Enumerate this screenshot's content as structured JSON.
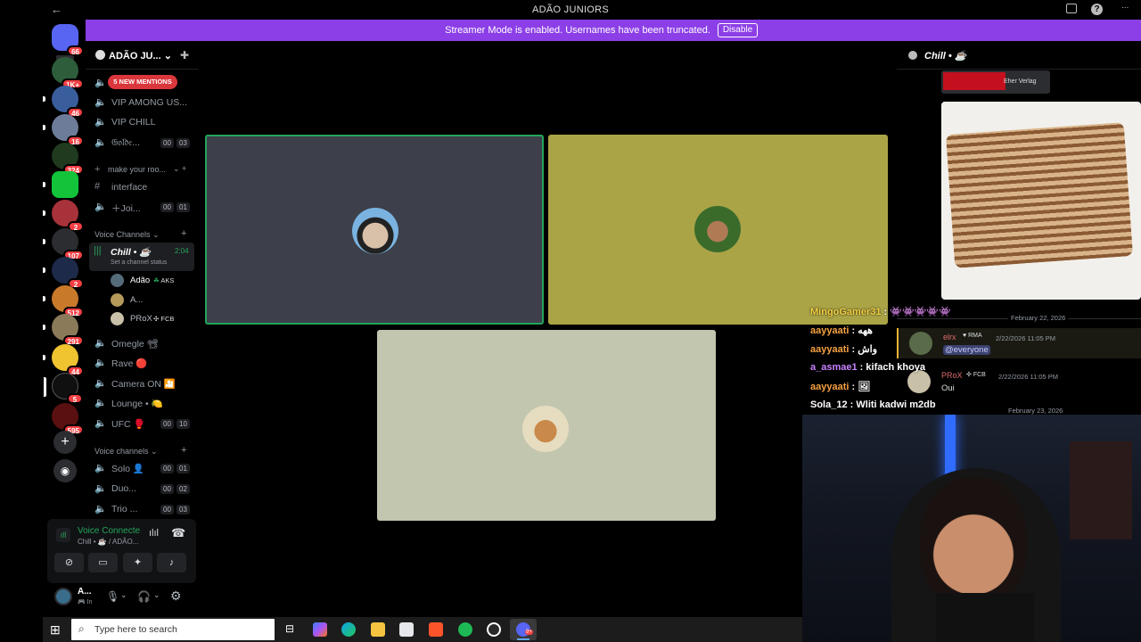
{
  "window": {
    "title": "ADÃO JUNIORS",
    "back_glyph": "←",
    "help_glyph": "?",
    "more_glyph": "..."
  },
  "banner": {
    "text": "Streamer Mode is enabled. Usernames have been truncated.",
    "button": "Disable"
  },
  "rail": {
    "badges": [
      "66",
      "1K+",
      "46",
      "16",
      "324",
      "2",
      "107",
      "2",
      "512",
      "291",
      "44",
      "5",
      "595"
    ]
  },
  "sidebar": {
    "guild_name": "ADÃO JU...",
    "new_mentions": "5 NEW MENTIONS",
    "channels": [
      {
        "name": "VIP AMONG US...",
        "icon": "speaker-icon"
      },
      {
        "name": "VIP CHILL",
        "icon": "speaker-icon"
      },
      {
        "name": "𝔊𝔬𝔩𝔡𝔢...",
        "icon": "speaker-icon",
        "c1": "00",
        "c2": "03"
      }
    ],
    "make_room": "make your roo...",
    "interface": "interface",
    "join": "Joi...",
    "join_c1": "00",
    "join_c2": "01",
    "voice_category": "Voice Channels",
    "active_channel": {
      "name": "Chill • ☕",
      "time": "2:04",
      "status": "Set a channel status"
    },
    "members": [
      {
        "name": "Adão",
        "tag": "AKS",
        "tag_glyph": "☘"
      },
      {
        "name": "A...",
        "tag": "",
        "tag_glyph": ""
      },
      {
        "name": "PRoX",
        "tag": "FCB",
        "tag_glyph": "✣"
      }
    ],
    "more_channels": [
      {
        "name": "Omegle 📽",
        "c1": "",
        "c2": ""
      },
      {
        "name": "Rave 🔴",
        "c1": "",
        "c2": ""
      },
      {
        "name": "Camera ON 🎦",
        "c1": "",
        "c2": ""
      },
      {
        "name": "Lounge • 🍋",
        "c1": "",
        "c2": ""
      },
      {
        "name": "UFC 🥊",
        "c1": "00",
        "c2": "10"
      }
    ],
    "voice_category2": "Voice channels",
    "bottom_channels": [
      {
        "name": "Solo 👤",
        "c1": "00",
        "c2": "01"
      },
      {
        "name": "Duo...",
        "c1": "00",
        "c2": "02"
      },
      {
        "name": "Trio ...",
        "c1": "00",
        "c2": "03"
      }
    ]
  },
  "voice_panel": {
    "status": "Voice Connecte",
    "sub": "Chill • ☕ / ADÃO..."
  },
  "user": {
    "name": "A...",
    "state": "In"
  },
  "tiles": [
    {
      "color": "#3d3f4a",
      "avatar": "#8fa5b8",
      "speaking": true
    },
    {
      "color": "#aaa447",
      "avatar": "#7a5a3b",
      "speaking": false
    },
    {
      "color": "#c3c6af",
      "avatar": "#b98a4a",
      "speaking": false
    }
  ],
  "chat": {
    "title": "Chill • ☕",
    "ad_text": "Eher Verlag",
    "date1": "February 22, 2026",
    "messages": [
      {
        "name": "elrx",
        "tag": "RMA",
        "time": "2/22/2026 11:05 PM",
        "body": "@everyone"
      },
      {
        "name": "PRoX",
        "tag": "FCB",
        "time": "2/22/2026 11:05 PM",
        "body": "Oui"
      }
    ],
    "date2": "February 23, 2026"
  },
  "stream_chat": [
    {
      "user": "MingoGamer31",
      "text": "👾👾👾👾👾",
      "color": "#f5d142"
    },
    {
      "user": "aayyaati",
      "text": "ههه",
      "color": "#f5a142"
    },
    {
      "user": "aayyaati",
      "text": "واش",
      "color": "#f5a142"
    },
    {
      "user": "a_asmae1",
      "text": "kifach khoya",
      "color": "#c882ff"
    },
    {
      "user": "aayyaati",
      "text": "🖼",
      "color": "#f5a142"
    },
    {
      "user": "Sola_12",
      "text": "Wliti kadwi m2db",
      "color": "#ffffff"
    }
  ],
  "taskbar": {
    "search_placeholder": "Type here to search",
    "notif_badge": "9+"
  }
}
